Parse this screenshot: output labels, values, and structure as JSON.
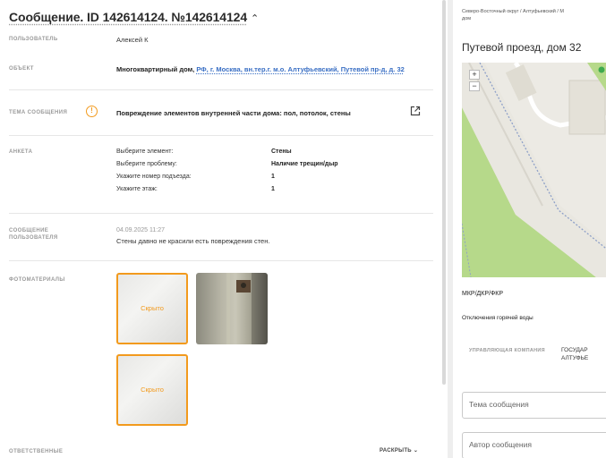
{
  "message": {
    "title": "Сообщение. ID 142614124. №142614124",
    "chevron": "^"
  },
  "fields": {
    "user_label": "ПОЛЬЗОВАТЕЛЬ",
    "user_value": "Алексей К",
    "object_label": "ОБЪЕКТ",
    "object_value_prefix": "Многоквартирный дом,",
    "object_value_link": "РФ, г. Москва, вн.тер.г. м.о. Алтуфьевский, Путевой пр-д, д. 32",
    "topic_label": "ТЕМА СООБЩЕНИЯ",
    "topic_value": "Повреждение элементов внутренней части дома: пол, потолок, стены",
    "form_label": "АНКЕТА",
    "form_rows": [
      {
        "key": "Выберите элемент:",
        "value": "Стены"
      },
      {
        "key": "Выберите проблему:",
        "value": "Наличие трещин/дыр"
      },
      {
        "key": "Укажите номер подъезда:",
        "value": "1"
      },
      {
        "key": "Укажите этаж:",
        "value": "1"
      }
    ],
    "user_message_label_1": "СООБЩЕНИЕ",
    "user_message_label_2": "ПОЛЬЗОВАТЕЛЯ",
    "user_message_date": "04.09.2025 11:27",
    "user_message_text": "Стены давно не красили есть повреждения стен.",
    "photos_label": "ФОТОМАТЕРИАЛЫ",
    "photo_hidden_caption": "Скрыто",
    "responsible_label": "ОТВЕТСТВЕННЫЕ",
    "expand_label": "РАСКРЫТЬ"
  },
  "right": {
    "breadcrumb_line1": "Северо-Восточный округ / Алтуфьевский / М",
    "breadcrumb_line2": "дом",
    "address_title": "Путевой проезд, дом 32",
    "zoom_in": "+",
    "zoom_out": "−",
    "mkr_label": "МКР/ДКР/ФКР",
    "hot_water_label": "Отключения горячей воды",
    "mgmt_label": "УПРАВЛЯЮЩАЯ КОМПАНИЯ",
    "mgmt_value_line1": "ГОСУДАР",
    "mgmt_value_line2": "АЛТУФЬЕ",
    "topic_placeholder": "Тема сообщения",
    "author_placeholder": "Автор сообщения"
  },
  "colors": {
    "accent_orange": "#f29a1d",
    "link_blue": "#3a6fc4",
    "map_green": "#b6d98a"
  },
  "icons": {
    "warning": "warning-icon",
    "external": "external-link-icon",
    "expand_chevron": "chevron-down-icon"
  }
}
